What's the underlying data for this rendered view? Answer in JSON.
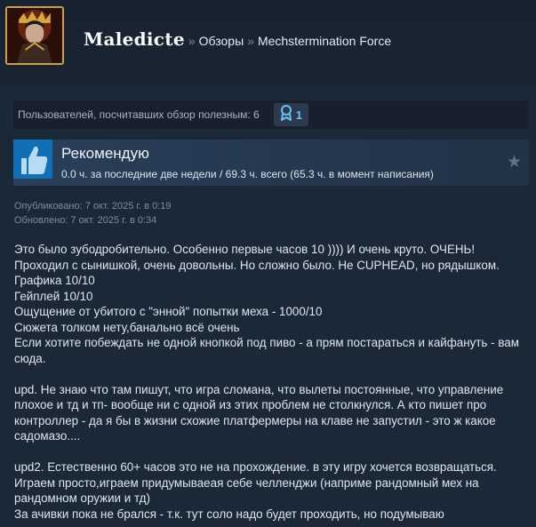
{
  "header": {
    "username": "Maledicte",
    "separator": "»",
    "crumbs": [
      "Обзоры",
      "Mechstermination Force"
    ]
  },
  "helpful": {
    "text": "Пользователей, посчитавших обзор полезным: 6",
    "award_count": "1",
    "award_icon": "award-ribbon-icon"
  },
  "recommendation": {
    "title": "Рекомендую",
    "hours": "0.0 ч. за последние две недели / 69.3 ч. всего (65.3 ч. в момент написания)",
    "thumb_icon": "thumbs-up-icon",
    "star_icon": "star-icon"
  },
  "dates": {
    "published": "Опубликовано: 7 окт. 2025 г. в 0:19",
    "updated": "Обновлено: 7 окт. 2025 г. в 0:34"
  },
  "review": {
    "p1": [
      "Это было зубодробительно. Особенно первые часов 10 )))) И очень круто. ОЧЕНЬ!",
      "Проходил с сынишкой, очень довольны. Но сложно было. Не CUPHEAD, но рядышком.",
      "Графика 10/10",
      "Гейплей 10/10",
      "Ощущение от убитого с \"энной\" попытки меха - 1000/10",
      "Сюжета толком нету,банально всё очень",
      "Если хотите побеждать не одной кнопкой под пиво - а прям постараться и кайфануть - вам сюда."
    ],
    "p2": "upd. Не знаю что там пишут, что игра сломана, что вылеты постоянные, что управление плохое и тд и тп- вообще ни с одной из этих проблем не столкнулся. А кто пишет про контроллер - да я бы в жизни схожие платфермеры на клаве не запустил - это ж какое садомазо....",
    "p3": [
      "upd2. Естественно 60+ часов это не на прохождение. в эту игру хочется возвращаться.",
      "Играем просто,играем придумываеая себе челленджи (наприме рандомный мех на рандомном оружии и тд)",
      "За ачивки пока не брался - т.к. тут соло надо будет проходить, но подумываю"
    ]
  },
  "colors": {
    "background": "#1b2838",
    "accent": "#67c1f5",
    "thumb": "#0f6fb7"
  }
}
